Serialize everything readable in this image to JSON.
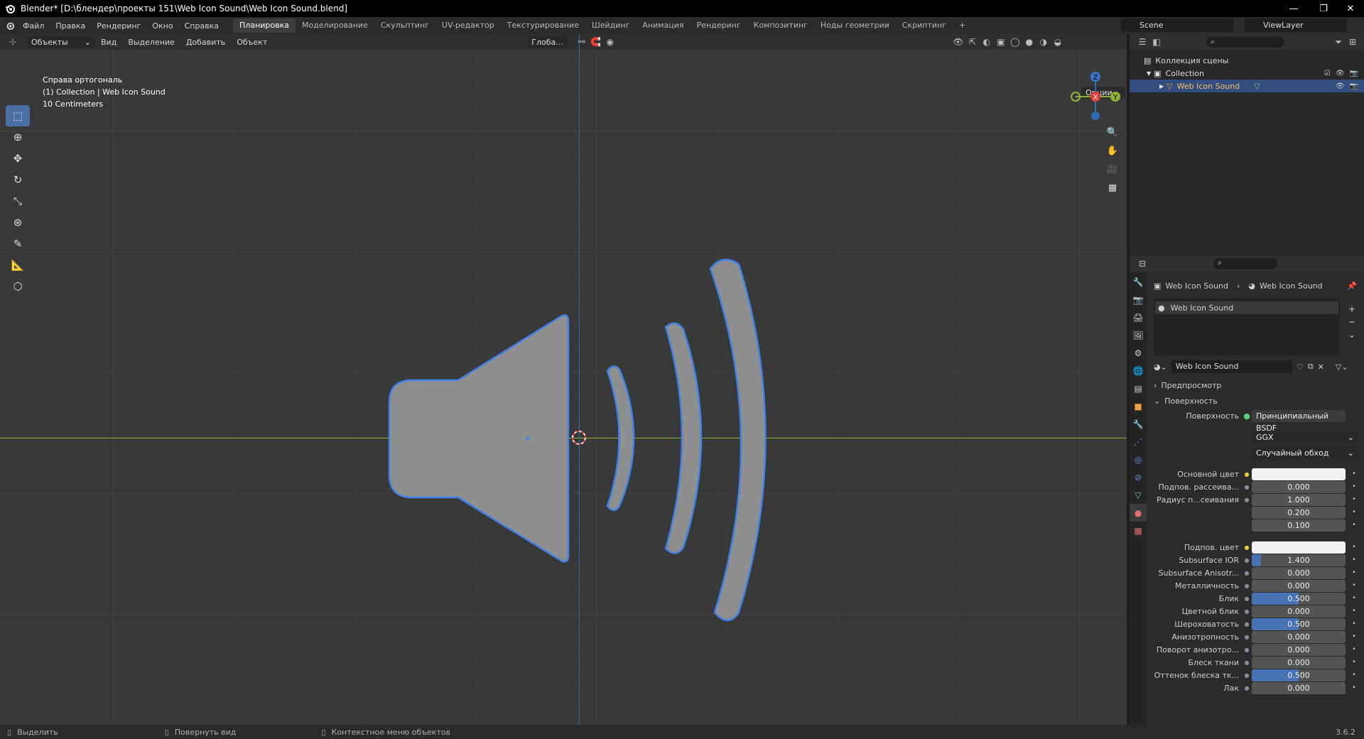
{
  "window": {
    "title": "Blender* [D:\\блендер\\проекты 151\\Web Icon Sound\\Web Icon Sound.blend]"
  },
  "menu": [
    "Файл",
    "Правка",
    "Рендеринг",
    "Окно",
    "Справка"
  ],
  "workspaces": [
    "Планировка",
    "Моделирование",
    "Скульптинг",
    "UV-редактор",
    "Текстурирование",
    "Шейдинг",
    "Анимация",
    "Рендеринг",
    "Композитинг",
    "Ноды геометрии",
    "Скриптинг"
  ],
  "workspace_add": "+",
  "scene": "Scene",
  "view_layer": "ViewLayer",
  "viewport": {
    "mode": "Объекты",
    "menus": [
      "Вид",
      "Выделение",
      "Добавить",
      "Объект"
    ],
    "orientation": "Глоба...",
    "options": "Опции",
    "overlay_lines": [
      "Справа ортогональ",
      "(1) Collection | Web Icon Sound",
      "10 Centimeters"
    ],
    "gizmo": {
      "z": "Z",
      "x": "X",
      "y": "Y"
    }
  },
  "outliner": {
    "rows": [
      {
        "label": "Коллекция сцены"
      },
      {
        "label": "Collection"
      },
      {
        "label": "Web Icon Sound"
      }
    ]
  },
  "properties": {
    "breadcrumb": [
      "Web Icon Sound",
      "Web Icon Sound"
    ],
    "material_slot": "Web Icon Sound",
    "material_name": "Web Icon Sound",
    "panel_preview": "Предпросмотр",
    "panel_surface": "Поверхность",
    "surface_label": "Поверхность",
    "surface_value": "Принципиальный BSDF",
    "distribution": "GGX",
    "subsurface_method": "Случайный обход",
    "rows": [
      {
        "label": "Основной цвет",
        "value": "",
        "type": "color",
        "color": "#f2f2f2"
      },
      {
        "label": "Подпов. рассеива...",
        "value": "0.000",
        "type": "num",
        "fill": 0
      },
      {
        "label": "Радиус п...сеивания",
        "value": "1.000",
        "type": "num",
        "fill": 0
      },
      {
        "label": "",
        "value": "0.200",
        "type": "num",
        "fill": 0
      },
      {
        "label": "",
        "value": "0.100",
        "type": "num",
        "fill": 0
      },
      {
        "label": "Подпов. цвет",
        "value": "",
        "type": "color",
        "color": "#f2f2f2"
      },
      {
        "label": "Subsurface IOR",
        "value": "1.400",
        "type": "num",
        "fill": 0.1
      },
      {
        "label": "Subsurface Anisotr...",
        "value": "0.000",
        "type": "num",
        "fill": 0
      },
      {
        "label": "Металличность",
        "value": "0.000",
        "type": "num",
        "fill": 0
      },
      {
        "label": "Блик",
        "value": "0.500",
        "type": "num",
        "fill": 0.5
      },
      {
        "label": "Цветной блик",
        "value": "0.000",
        "type": "num",
        "fill": 0
      },
      {
        "label": "Шероховатость",
        "value": "0.500",
        "type": "num",
        "fill": 0.5
      },
      {
        "label": "Анизотропность",
        "value": "0.000",
        "type": "num",
        "fill": 0
      },
      {
        "label": "Поворот анизотро...",
        "value": "0.000",
        "type": "num",
        "fill": 0
      },
      {
        "label": "Блеск ткани",
        "value": "0.000",
        "type": "num",
        "fill": 0
      },
      {
        "label": "Оттенок блеска тк...",
        "value": "0.500",
        "type": "num",
        "fill": 0.5
      },
      {
        "label": "Лак",
        "value": "0.000",
        "type": "num",
        "fill": 0
      }
    ]
  },
  "statusbar": {
    "items": [
      "Выделить",
      "Повернуть вид",
      "Контекстное меню объектов"
    ],
    "version": "3.6.2"
  },
  "colors": {
    "accent": "#4772b3",
    "selection": "#334d80",
    "object_fill": "#8f8f8f",
    "object_outline": "#3f82e8",
    "axis_x": "#8db234",
    "axis_y": "#2f6bb3"
  }
}
